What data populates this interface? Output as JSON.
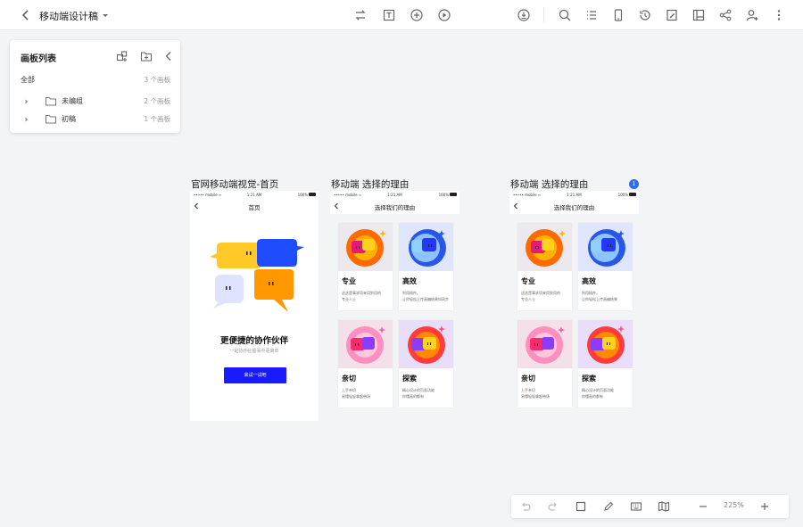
{
  "topbar": {
    "title": "移动端设计稿",
    "icons": [
      "back-icon",
      "caret-down-icon",
      "swap-icon",
      "text-icon",
      "add-circle-icon",
      "play-icon",
      "export-icon",
      "search-icon",
      "list-icon",
      "device-icon",
      "history-icon",
      "annotate-icon",
      "layout-icon",
      "share-icon",
      "add-user-icon",
      "more-icon"
    ]
  },
  "panel": {
    "title": "画板列表",
    "all_label": "全部",
    "all_count": "3 个画板",
    "groups": [
      {
        "label": "未编组",
        "count": "2 个画板"
      },
      {
        "label": "初稿",
        "count": "1 个画板"
      }
    ]
  },
  "artboards": [
    {
      "title": "官网移动端视觉-首页",
      "status": {
        "carrier": "••••• mobile ≈",
        "time": "1:21 AM",
        "battery": "100%"
      },
      "nav_title": "首页",
      "hero_title": "更便捷的协作伙伴",
      "hero_subtitle": "一起协作社图事中更简单",
      "cta": "来试一试吧"
    },
    {
      "title": "移动端 选择的理由",
      "status": {
        "carrier": "••••• mobile ≈",
        "time": "1:21 AM",
        "battery": "100%"
      },
      "nav_title": "选择我们的理由",
      "cards": [
        {
          "title": "专业",
          "line1": "这这是事求项来用到用的",
          "line2": "专业人士"
        },
        {
          "title": "高效",
          "line1": "利用插件。",
          "line2": "让你轻松上传画编结果如同步"
        },
        {
          "title": "亲切",
          "line1": "上手亲切",
          "line2": "易懂轻轻拿起带场"
        },
        {
          "title": "探索",
          "line1": "精心设计的页面功能",
          "line2": "你懂画的都有"
        }
      ]
    },
    {
      "title": "移动端 选择的理由",
      "badge": "1",
      "status": {
        "carrier": "••••• mobile ≈",
        "time": "1:21 AM",
        "battery": "100%"
      },
      "nav_title": "选择我们的理由",
      "cards": [
        {
          "title": "专业",
          "line1": "这这是事求项来用到用的",
          "line2": "专业人士"
        },
        {
          "title": "高效",
          "line1": "利用插件。",
          "line2": "让你轻松上传画编结果"
        },
        {
          "title": "亲切",
          "line1": "上手亲切",
          "line2": "易懂轻轻拿起带场"
        },
        {
          "title": "探索",
          "line1": "精心设计的页面功能",
          "line2": "你懂画的都有"
        }
      ]
    }
  ],
  "bottombar": {
    "zoom": "225%"
  },
  "colors": {
    "accent": "#2f6cf6",
    "cta": "#1a1aff",
    "canvas": "#f3f4f6"
  }
}
